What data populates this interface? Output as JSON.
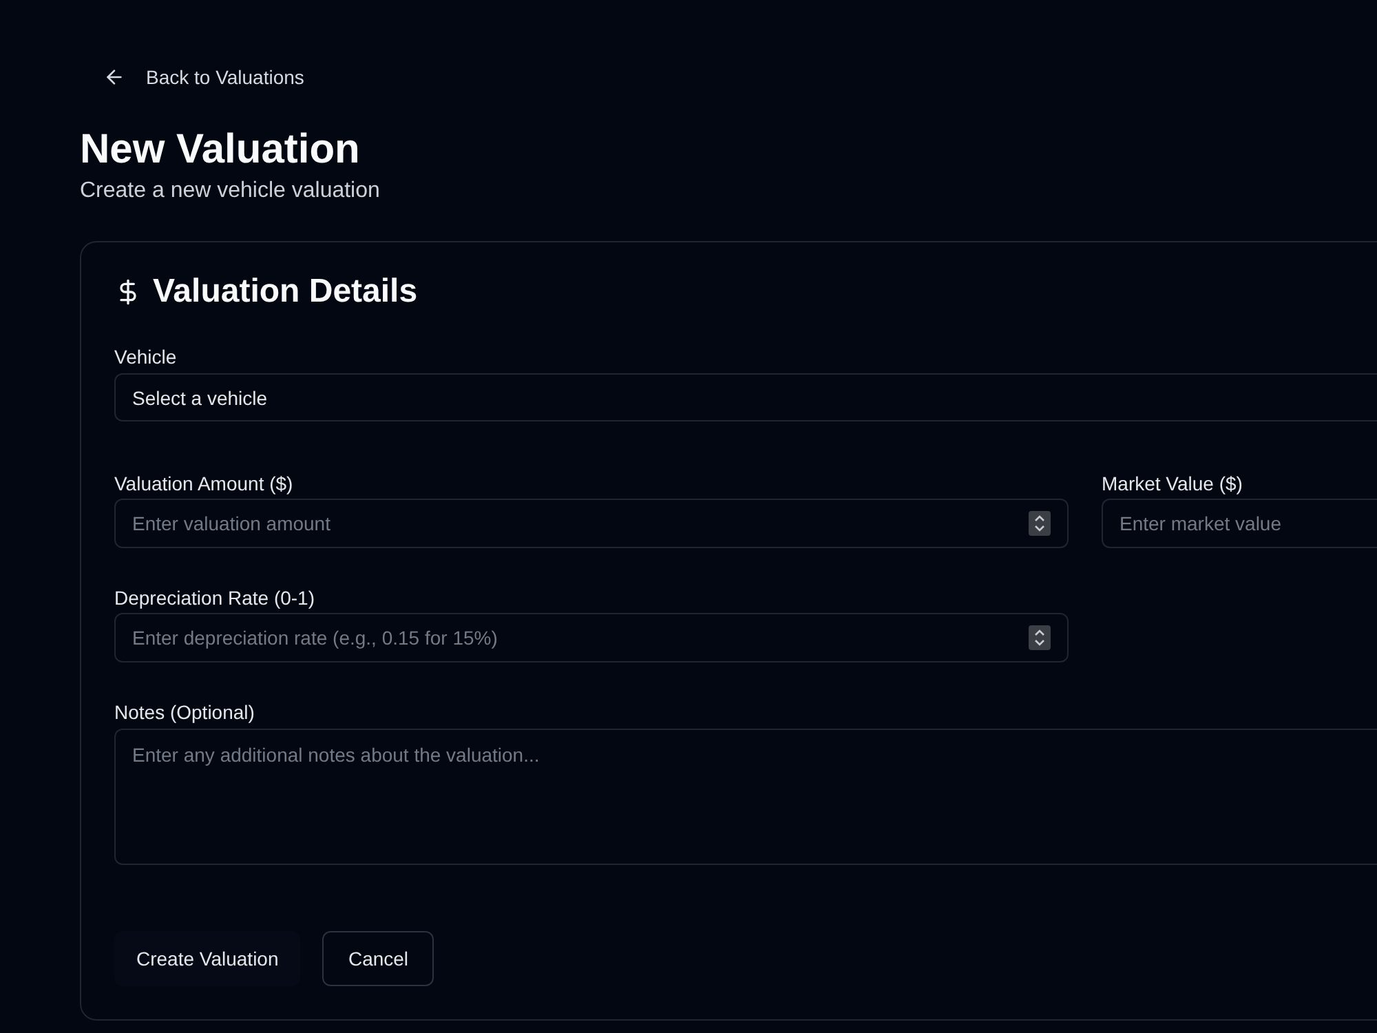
{
  "back_link": {
    "label": "Back to Valuations"
  },
  "header": {
    "title": "New Valuation",
    "subtitle": "Create a new vehicle valuation"
  },
  "card": {
    "title": "Valuation Details",
    "fields": [
      {
        "kind": "select",
        "label": "Vehicle",
        "placeholder": "Select a vehicle"
      },
      {
        "kind": "number",
        "label": "Valuation Amount ($)",
        "placeholder": "Enter valuation amount"
      },
      {
        "kind": "text",
        "label": "Market Value ($)",
        "placeholder": "Enter market value"
      },
      {
        "kind": "number",
        "label": "Depreciation Rate (0-1)",
        "placeholder": "Enter depreciation rate (e.g., 0.15 for 15%)"
      },
      {
        "kind": "textarea",
        "label": "Notes (Optional)",
        "placeholder": "Enter any additional notes about the valuation..."
      }
    ],
    "buttons": [
      {
        "kind": "primary",
        "label": "Create Valuation"
      },
      {
        "kind": "outline",
        "label": "Cancel"
      }
    ]
  }
}
